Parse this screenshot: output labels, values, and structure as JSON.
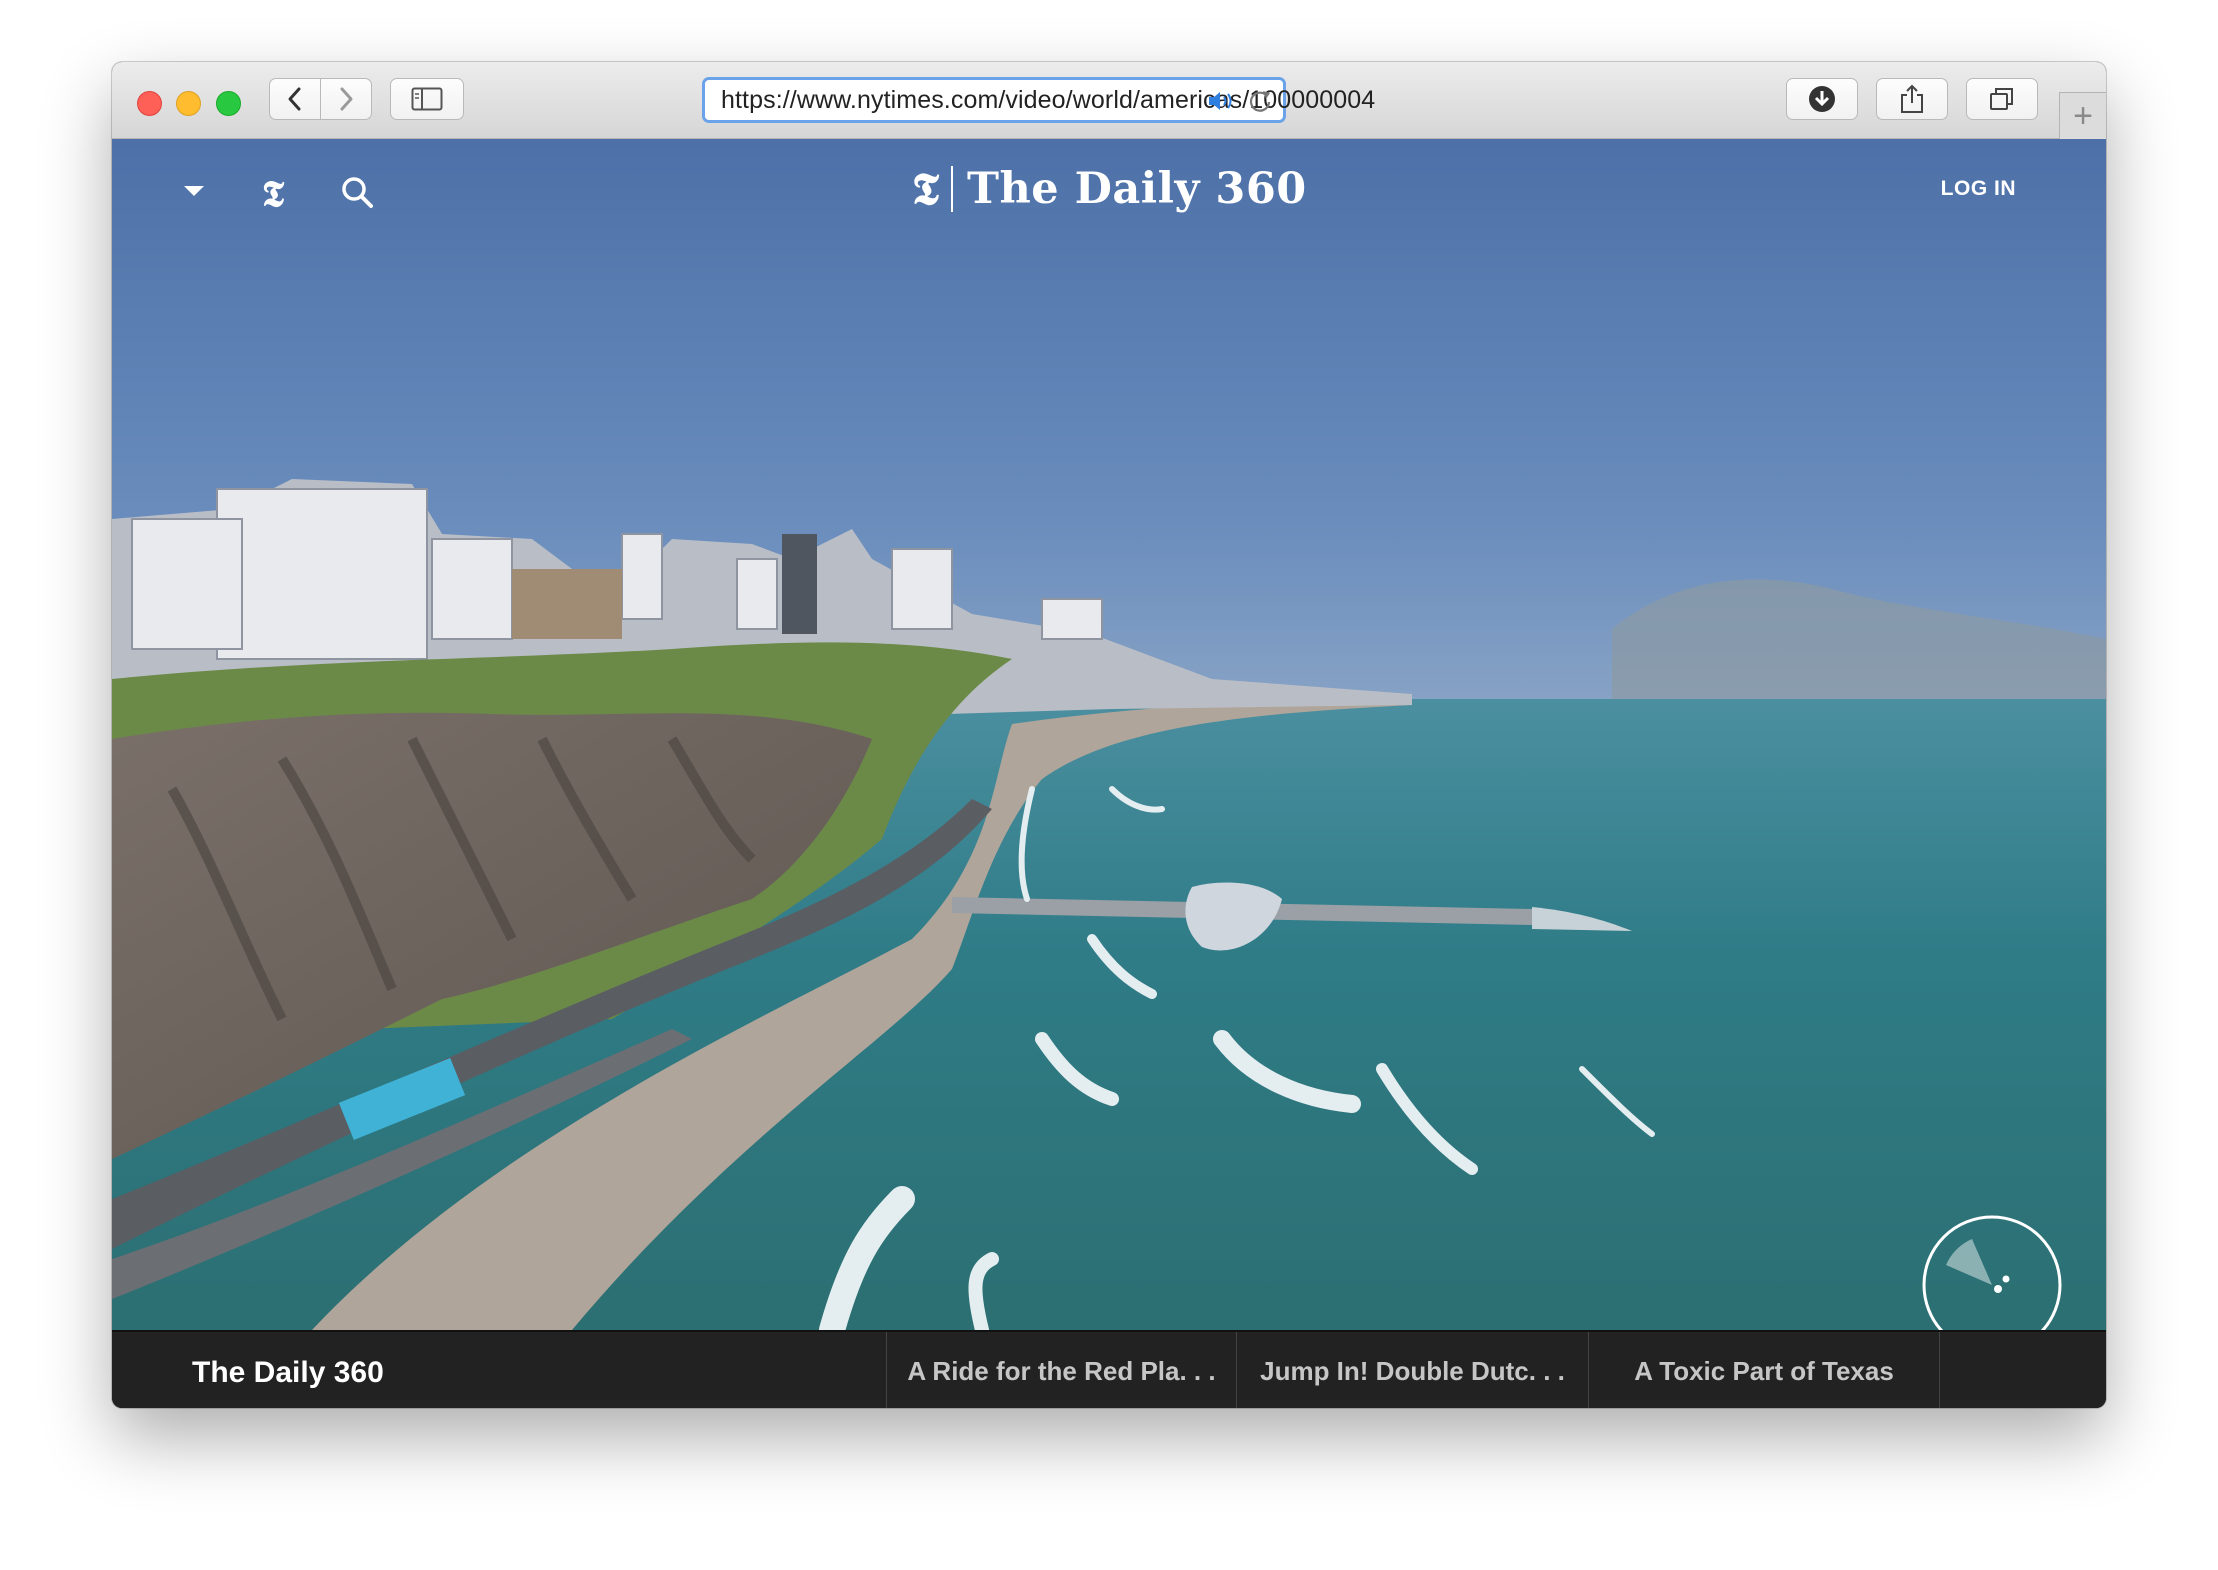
{
  "browser": {
    "url": "https://www.nytimes.com/video/world/americas/100000004",
    "buttons": {
      "back": "chevron-left-icon",
      "forward": "chevron-right-icon",
      "sidebar": "sidebar-icon",
      "downloads": "download-icon",
      "share": "share-icon",
      "tabs": "tabs-overview-icon",
      "new_tab": "+"
    }
  },
  "header": {
    "logo_mark": "𝕿",
    "title": "The Daily 360",
    "login_label": "LOG IN",
    "icons": [
      "chevron-down-icon",
      "nyt-logo-icon",
      "search-icon"
    ]
  },
  "footer": {
    "title": "The Daily 360",
    "related": [
      "A Ride for the Red Pla. . .",
      "Jump In! Double Dutc. . .",
      "A Toxic Part of Texas"
    ]
  },
  "colors": {
    "sky": "#4f76b0",
    "sea": "#2e7b86",
    "footer": "#222222",
    "url_focus": "#6aa3ea"
  }
}
